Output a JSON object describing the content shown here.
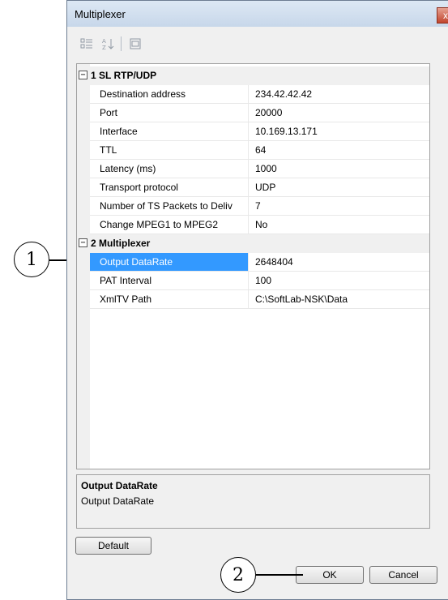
{
  "window": {
    "title": "Multiplexer",
    "close_glyph": "x"
  },
  "toolbar": {
    "icons": [
      "categorized-icon",
      "alphabetical-icon",
      "property-pages-icon"
    ]
  },
  "categories": [
    {
      "toggle": "−",
      "label": "1 SL RTP/UDP",
      "rows": [
        {
          "name": "Destination address",
          "value": "234.42.42.42"
        },
        {
          "name": "Port",
          "value": "20000"
        },
        {
          "name": "Interface",
          "value": "10.169.13.171"
        },
        {
          "name": "TTL",
          "value": "64"
        },
        {
          "name": "Latency (ms)",
          "value": "1000"
        },
        {
          "name": "Transport protocol",
          "value": "UDP"
        },
        {
          "name": "Number of TS Packets to Deliv",
          "value": "7"
        },
        {
          "name": "Change MPEG1 to MPEG2",
          "value": "No"
        }
      ]
    },
    {
      "toggle": "−",
      "label": "2 Multiplexer",
      "rows": [
        {
          "name": "Output DataRate",
          "value": "2648404"
        },
        {
          "name": "PAT Interval",
          "value": "100"
        },
        {
          "name": "XmlTV Path",
          "value": "C:\\SoftLab-NSK\\Data"
        }
      ]
    }
  ],
  "description": {
    "title": "Output DataRate",
    "text": "Output DataRate"
  },
  "buttons": {
    "default": "Default",
    "ok": "OK",
    "cancel": "Cancel"
  },
  "callouts": {
    "one": "1",
    "two": "2"
  },
  "colors": {
    "selection": "#3399ff"
  }
}
